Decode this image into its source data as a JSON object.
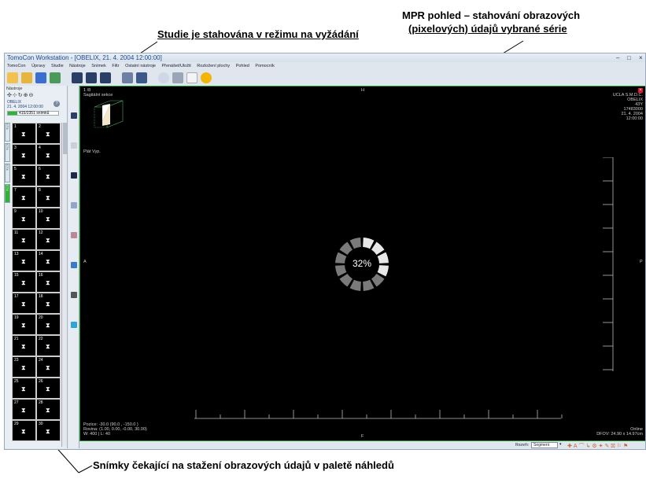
{
  "callouts": {
    "mpr": "MPR pohled – stahování obrazových (pixelových) údajů vybrané série",
    "mpr_line1": "MPR pohled – stahování obrazových",
    "mpr_line2": "(pixelových) údajů vybrané série",
    "study": "Studie je stahována v režimu na vyžádání",
    "thumbs": "Snímky čekající na stažení obrazových údajů v paletě náhledů"
  },
  "window": {
    "title": "TomoCon Workstation - [OBELIX, 21. 4. 2004 12:00:00]",
    "minimize": "–",
    "maximize": "□",
    "close": "×"
  },
  "menu": [
    "TomoCon",
    "Úpravy",
    "Studie",
    "Nástroje",
    "Snímek",
    "Filtr",
    "Ostatní nástroje",
    "Přenášet/Uložit",
    "Rozložení plochy",
    "Pohled",
    "Pomocník"
  ],
  "left_panel": {
    "title": "Nástroje",
    "study_name": "OBELIX",
    "study_date": "21. 4. 2004 12:00:00",
    "progress_text": "415/2351 snímků",
    "progress_fraction": 0.18,
    "tabs": [
      "CT4",
      "CT4",
      "CT4",
      "CT4"
    ],
    "thumbnails": [
      "1",
      "2",
      "3",
      "4",
      "5",
      "6",
      "7",
      "8",
      "9",
      "10",
      "11",
      "12",
      "13",
      "14",
      "15",
      "16",
      "17",
      "18",
      "19",
      "20",
      "21",
      "22",
      "23",
      "24",
      "25",
      "26",
      "27",
      "28",
      "29",
      "30"
    ]
  },
  "viewer": {
    "top_left_1": "1 /8",
    "top_left_2": "Sagitální sekce",
    "top_marker": "H",
    "bottom_marker": "F",
    "left_marker": "A",
    "right_marker": "P",
    "plate_label": "Plát Vyp.",
    "top_right": [
      "UCLA S.M.D.C.",
      "OBELIX",
      "43Y",
      "17483000",
      "21. 4. 2004",
      "12:00:00"
    ],
    "loading_percent": "32%",
    "loading_fraction": 0.32,
    "bottom_left": [
      "Pozice: -30.0 (90.0 , -150.0 )",
      "Rovina: (1.00, 0.00, -0.00, 30.00)",
      "W: 400 | L: 40"
    ],
    "bottom_right": [
      "Online",
      "DFOV: 24.90 x 14.97cm"
    ]
  },
  "statusbar": {
    "layout_label": "Rozvrh:",
    "layout_value": "Segment"
  },
  "colors": {
    "progress_green": "#2db62d",
    "viewport_border": "#1e9a2a",
    "close_red": "#e81123"
  }
}
